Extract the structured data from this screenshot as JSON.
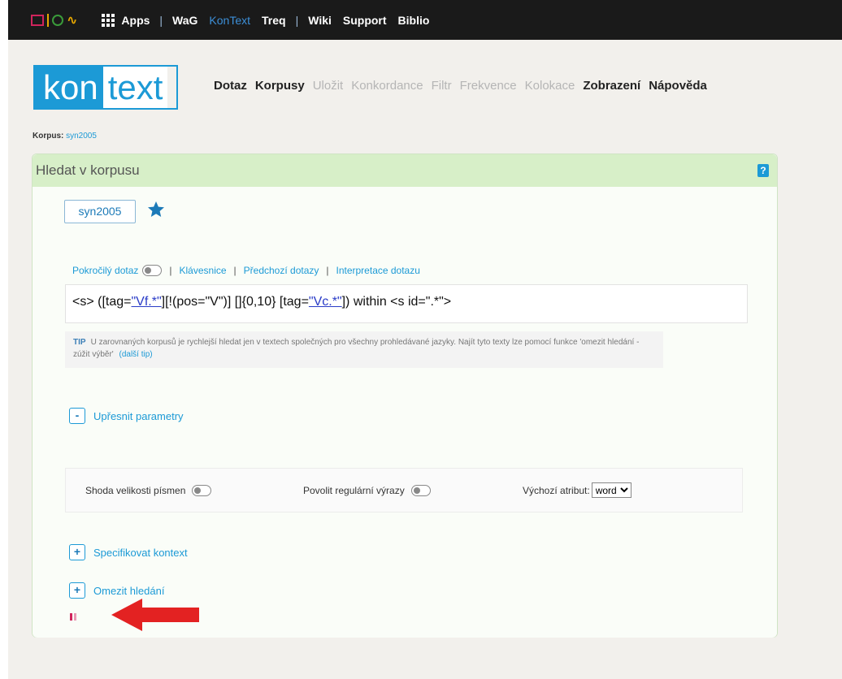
{
  "topbar": {
    "apps_label": "Apps",
    "links": [
      "WaG",
      "KonText",
      "Treq",
      "Wiki",
      "Support",
      "Biblio"
    ],
    "active_link": "KonText"
  },
  "header": {
    "logo_part1": "kon",
    "logo_part2": "text",
    "menu": [
      {
        "label": "Dotaz",
        "enabled": true
      },
      {
        "label": "Korpusy",
        "enabled": true
      },
      {
        "label": "Uložit",
        "enabled": false
      },
      {
        "label": "Konkordance",
        "enabled": false
      },
      {
        "label": "Filtr",
        "enabled": false
      },
      {
        "label": "Frekvence",
        "enabled": false
      },
      {
        "label": "Kolokace",
        "enabled": false
      },
      {
        "label": "Zobrazení",
        "enabled": true
      },
      {
        "label": "Nápověda",
        "enabled": true
      }
    ]
  },
  "corpus_info": {
    "label": "Korpus:",
    "value": "syn2005"
  },
  "panel": {
    "title": "Hledat v korpusu",
    "help_icon": "?",
    "corpus_tag": "syn2005",
    "links": {
      "advanced": "Pokročilý dotaz",
      "keyboard": "Klávesnice",
      "history": "Předchozí dotazy",
      "interpret": "Interpretace dotazu"
    },
    "query": {
      "p1": "<s> ([tag=",
      "u1": "\"Vf.*\"",
      "p2": "][!(pos=\"V\")] []{0,10} [tag=",
      "u2": "\"Vc.*\"",
      "p3": "]) within <s id=\".*\">"
    },
    "tip": {
      "label": "TIP",
      "text": "U zarovnaných korpusů je rychlejší hledat jen v textech společných pro všechny prohledávané jazyky. Najít tyto texty lze pomocí funkce 'omezit hledání - zúžit výběr'",
      "more": "(další tip)"
    },
    "refine": {
      "button": "-",
      "label": "Upřesnit parametry"
    },
    "params": {
      "case_label": "Shoda velikosti písmen",
      "regex_label": "Povolit regulární výrazy",
      "attr_label": "Výchozí atribut:",
      "attr_value": "word"
    },
    "context": {
      "button": "+",
      "label": "Specifikovat kontext"
    },
    "restrict": {
      "button": "+",
      "label": "Omezit hledání"
    }
  },
  "colors": {
    "accent": "#1c9ad6",
    "panel_head": "#d7efc8",
    "arrow": "#e32222",
    "brand_pink": "#d0245c"
  }
}
